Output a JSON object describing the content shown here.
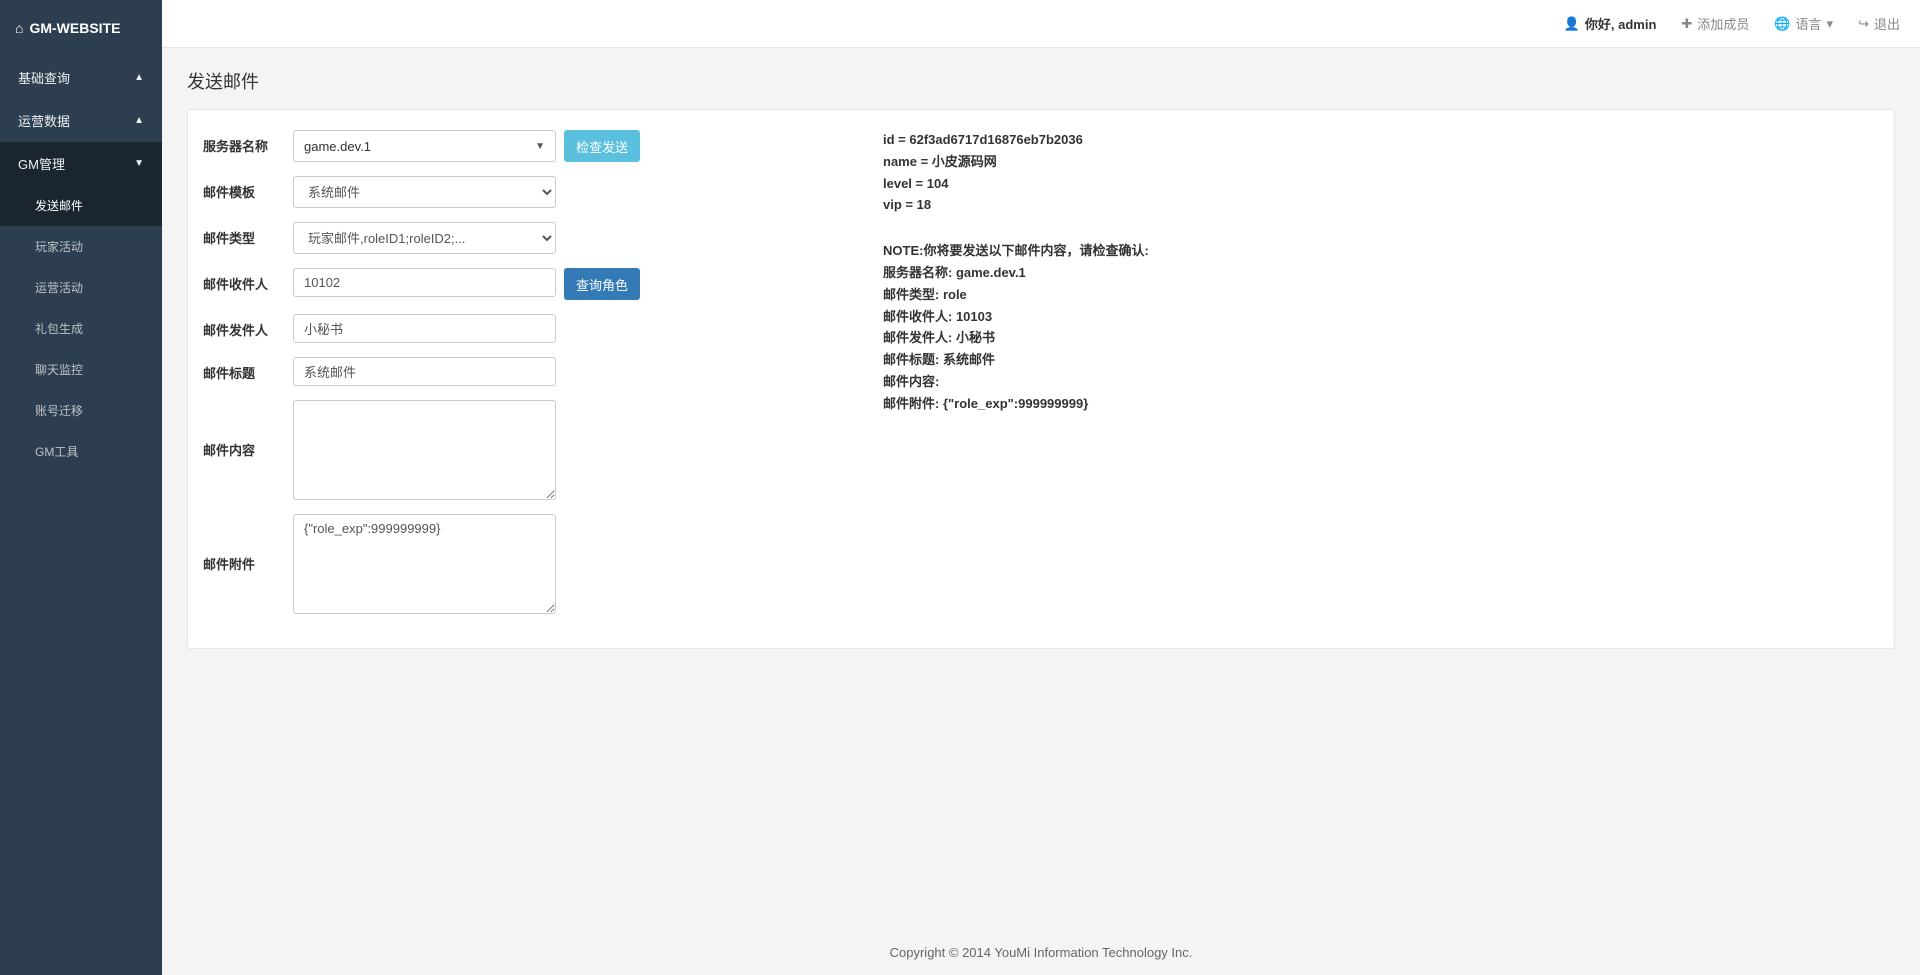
{
  "brand": "GM-WEBSITE",
  "sidebar": {
    "sections": [
      {
        "label": "基础查询",
        "expanded": false
      },
      {
        "label": "运营数据",
        "expanded": false
      },
      {
        "label": "GM管理",
        "expanded": true,
        "items": [
          {
            "label": "发送邮件",
            "selected": true
          },
          {
            "label": "玩家活动"
          },
          {
            "label": "运营活动"
          },
          {
            "label": "礼包生成"
          },
          {
            "label": "聊天监控"
          },
          {
            "label": "账号迁移"
          },
          {
            "label": "GM工具"
          }
        ]
      }
    ]
  },
  "topbar": {
    "greeting": "你好, admin",
    "add_member": "添加成员",
    "language": "语言",
    "logout": "退出"
  },
  "page": {
    "title": "发送邮件"
  },
  "form": {
    "server_name": {
      "label": "服务器名称",
      "value": "game.dev.1"
    },
    "check_send_btn": "检查发送",
    "mail_template": {
      "label": "邮件模板",
      "value": "系统邮件"
    },
    "mail_type": {
      "label": "邮件类型",
      "value": "玩家邮件,roleID1;roleID2;..."
    },
    "recipient": {
      "label": "邮件收件人",
      "value": "10102"
    },
    "query_role_btn": "查询角色",
    "sender": {
      "label": "邮件发件人",
      "value": "小秘书"
    },
    "mail_title": {
      "label": "邮件标题",
      "value": "系统邮件"
    },
    "mail_content": {
      "label": "邮件内容",
      "value": ""
    },
    "mail_attachment": {
      "label": "邮件附件",
      "value": "{\"role_exp\":999999999}"
    }
  },
  "info": {
    "role": {
      "id": "id = 62f3ad6717d16876eb7b2036",
      "name": "name = 小皮源码网",
      "level": "level = 104",
      "vip": "vip = 18"
    },
    "note": {
      "header": "NOTE:你将要发送以下邮件内容，请检查确认:",
      "server": "服务器名称: game.dev.1",
      "type": "邮件类型: role",
      "recipient": "邮件收件人: 10103",
      "sender": "邮件发件人: 小秘书",
      "title": "邮件标题: 系统邮件",
      "content": "邮件内容:",
      "attachment": "邮件附件: {\"role_exp\":999999999}"
    }
  },
  "footer": "Copyright © 2014 YouMi Information Technology Inc."
}
